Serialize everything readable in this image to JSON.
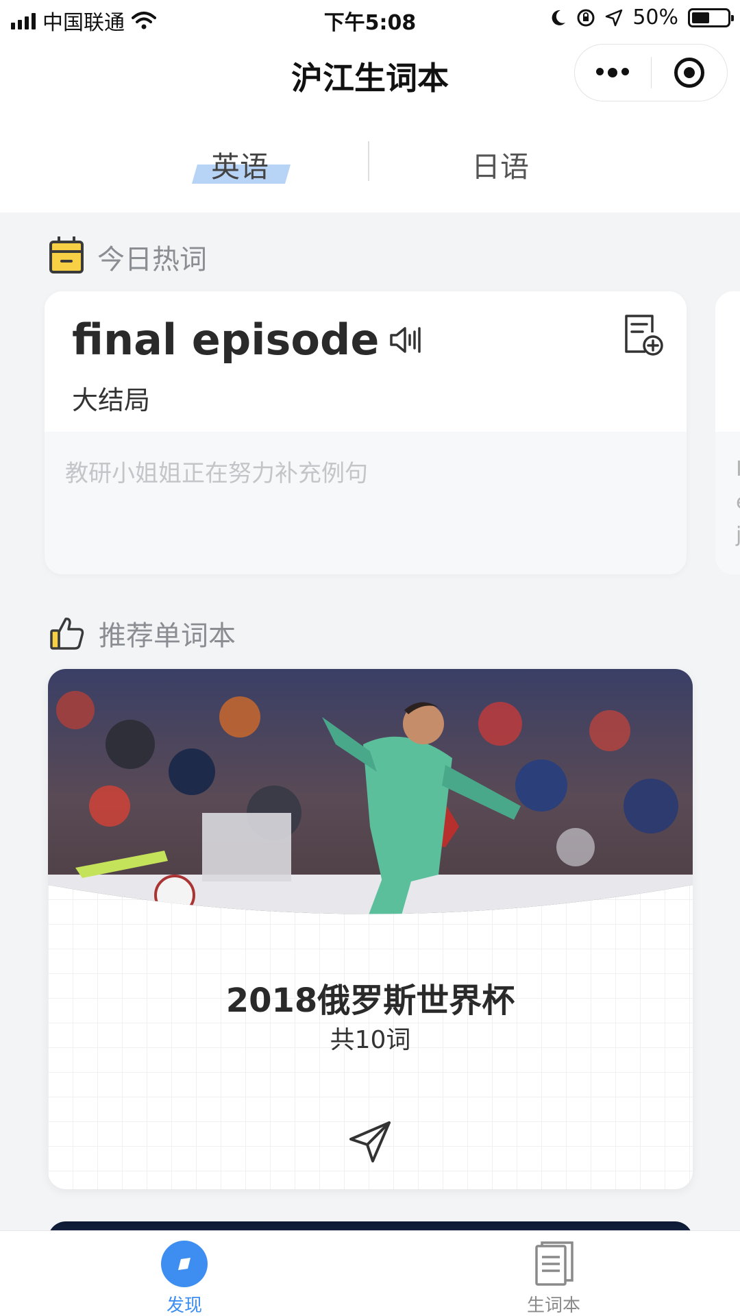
{
  "status_bar": {
    "carrier": "中国联通",
    "time": "下午5:08",
    "battery_text": "50%",
    "battery_level": 0.5
  },
  "nav": {
    "title": "沪江生词本",
    "more_icon": "more-dots-icon",
    "close_icon": "target-icon"
  },
  "language_tabs": [
    {
      "label": "英语",
      "active": true
    },
    {
      "label": "日语",
      "active": false
    }
  ],
  "hot_words": {
    "section_title": "今日热词",
    "icon": "calendar-icon",
    "card": {
      "word": "final episode",
      "meaning": "大结局",
      "example_placeholder": "教研小姐姐正在努力补充例句",
      "audio_icon": "speaker-icon",
      "add_icon": "add-to-wordbook-icon"
    },
    "peek_card_lines": [
      "I",
      "e",
      "j"
    ]
  },
  "recommend": {
    "section_title": "推荐单词本",
    "icon": "thumbs-up-icon",
    "card": {
      "title": "2018俄罗斯世界杯",
      "count": "共10词",
      "image": "soccer-player-photo",
      "action_icon": "send-icon"
    }
  },
  "tab_bar": {
    "items": [
      {
        "label": "发现",
        "icon": "discover-icon",
        "active": true
      },
      {
        "label": "生词本",
        "icon": "wordbook-icon",
        "active": false
      }
    ]
  },
  "colors": {
    "accent": "#3d8ef0",
    "highlight": "#b7d3f5",
    "icon_yellow": "#f7d046",
    "background": "#f3f4f6"
  }
}
